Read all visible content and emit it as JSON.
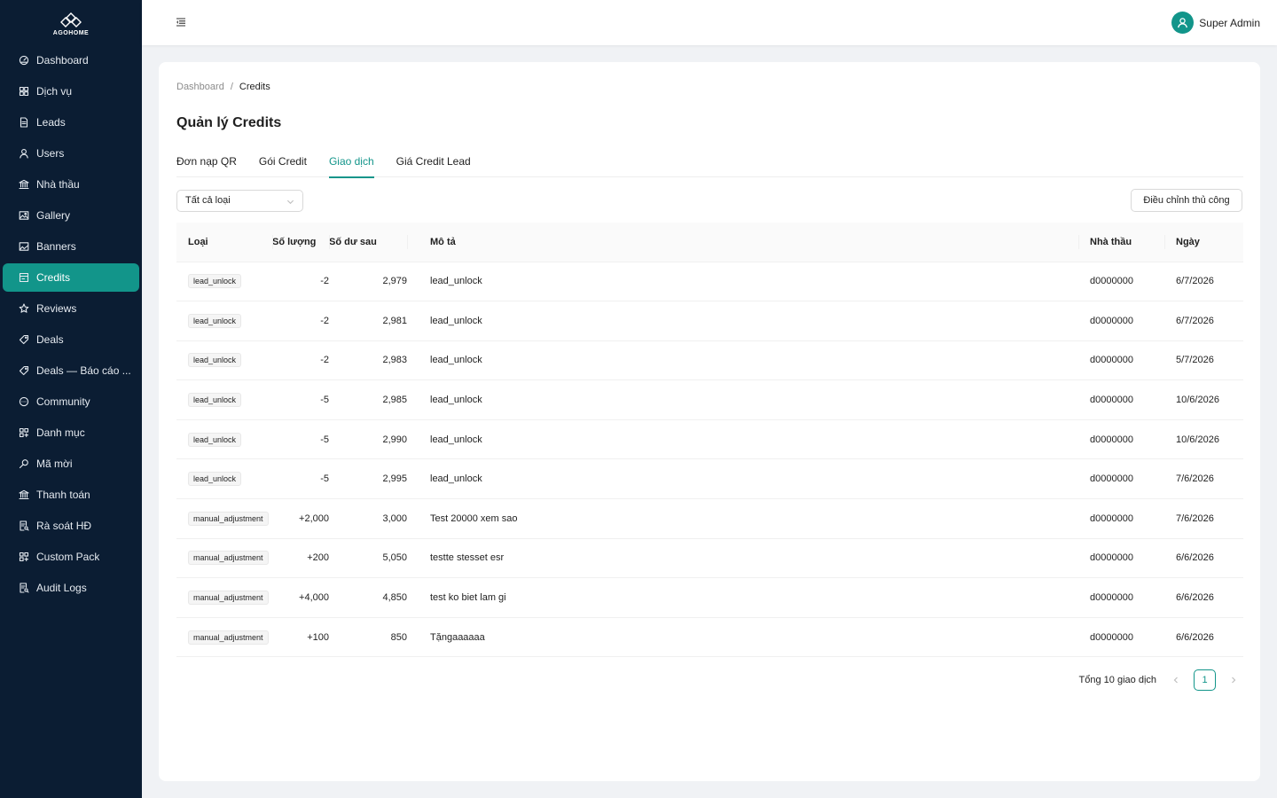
{
  "brand": {
    "name": "AGOHOME",
    "accent": "#12958a",
    "sidebar_bg": "#0b1d33"
  },
  "sidebar": {
    "items": [
      {
        "label": "Dashboard",
        "icon": "dashboard-icon"
      },
      {
        "label": "Dịch vụ",
        "icon": "grid-icon"
      },
      {
        "label": "Leads",
        "icon": "file-icon"
      },
      {
        "label": "Users",
        "icon": "user-icon"
      },
      {
        "label": "Nhà thầu",
        "icon": "bank-icon"
      },
      {
        "label": "Gallery",
        "icon": "image-icon"
      },
      {
        "label": "Banners",
        "icon": "picture-icon"
      },
      {
        "label": "Credits",
        "icon": "wallet-icon",
        "active": true
      },
      {
        "label": "Reviews",
        "icon": "star-icon"
      },
      {
        "label": "Deals",
        "icon": "tag-icon"
      },
      {
        "label": "Deals — Báo cáo ...",
        "icon": "tag-icon"
      },
      {
        "label": "Community",
        "icon": "message-icon"
      },
      {
        "label": "Danh mục",
        "icon": "appstore-icon"
      },
      {
        "label": "Mã mời",
        "icon": "key-icon"
      },
      {
        "label": "Thanh toán",
        "icon": "bank-icon"
      },
      {
        "label": "Rà soát HĐ",
        "icon": "audit-icon"
      },
      {
        "label": "Custom Pack",
        "icon": "appstore-icon"
      },
      {
        "label": "Audit Logs",
        "icon": "audit-icon"
      }
    ]
  },
  "header": {
    "user_name": "Super Admin"
  },
  "breadcrumb": {
    "parent": "Dashboard",
    "separator": "/",
    "current": "Credits"
  },
  "page": {
    "title": "Quản lý Credits"
  },
  "tabs": [
    {
      "label": "Đơn nạp QR"
    },
    {
      "label": "Gói Credit"
    },
    {
      "label": "Giao dịch",
      "active": true
    },
    {
      "label": "Giá Credit Lead"
    }
  ],
  "filter": {
    "selected": "Tất cả loại"
  },
  "toolbar": {
    "adjust_label": "Điều chỉnh thủ công"
  },
  "table": {
    "columns": {
      "type": "Loại",
      "qty": "Số lượng",
      "balance": "Số dư sau",
      "desc": "Mô tả",
      "contractor": "Nhà thầu",
      "date": "Ngày"
    },
    "rows": [
      {
        "type": "lead_unlock",
        "qty": "-2",
        "balance": "2,979",
        "desc": "lead_unlock",
        "contractor": "d0000000",
        "date": "6/7/2026"
      },
      {
        "type": "lead_unlock",
        "qty": "-2",
        "balance": "2,981",
        "desc": "lead_unlock",
        "contractor": "d0000000",
        "date": "6/7/2026"
      },
      {
        "type": "lead_unlock",
        "qty": "-2",
        "balance": "2,983",
        "desc": "lead_unlock",
        "contractor": "d0000000",
        "date": "5/7/2026"
      },
      {
        "type": "lead_unlock",
        "qty": "-5",
        "balance": "2,985",
        "desc": "lead_unlock",
        "contractor": "d0000000",
        "date": "10/6/2026"
      },
      {
        "type": "lead_unlock",
        "qty": "-5",
        "balance": "2,990",
        "desc": "lead_unlock",
        "contractor": "d0000000",
        "date": "10/6/2026"
      },
      {
        "type": "lead_unlock",
        "qty": "-5",
        "balance": "2,995",
        "desc": "lead_unlock",
        "contractor": "d0000000",
        "date": "7/6/2026"
      },
      {
        "type": "manual_adjustment",
        "qty": "+2,000",
        "balance": "3,000",
        "desc": "Test 20000 xem sao",
        "contractor": "d0000000",
        "date": "7/6/2026"
      },
      {
        "type": "manual_adjustment",
        "qty": "+200",
        "balance": "5,050",
        "desc": "testte stesset esr",
        "contractor": "d0000000",
        "date": "6/6/2026"
      },
      {
        "type": "manual_adjustment",
        "qty": "+4,000",
        "balance": "4,850",
        "desc": "test ko biet lam gi",
        "contractor": "d0000000",
        "date": "6/6/2026"
      },
      {
        "type": "manual_adjustment",
        "qty": "+100",
        "balance": "850",
        "desc": "Tặngaaaaaa",
        "contractor": "d0000000",
        "date": "6/6/2026"
      }
    ]
  },
  "pagination": {
    "total_label": "Tổng 10 giao dịch",
    "current_page": "1"
  }
}
